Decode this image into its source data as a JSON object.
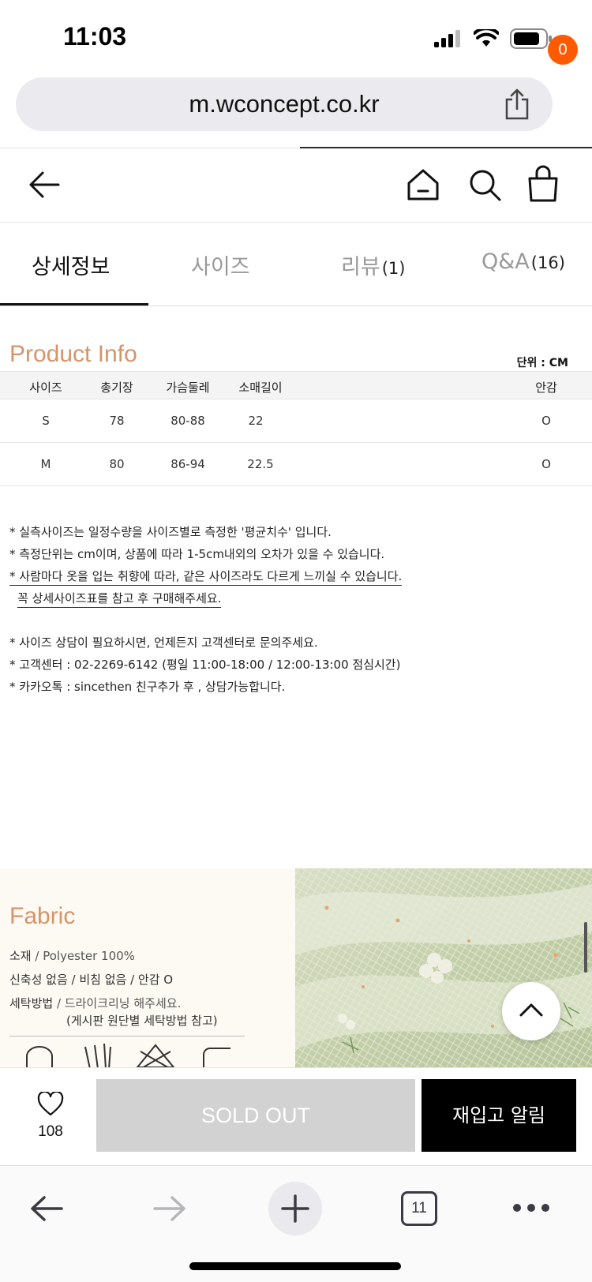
{
  "status_bar": {
    "time": "11:03"
  },
  "browser": {
    "url": "m.wconcept.co.kr",
    "tab_count": "11"
  },
  "header": {
    "cart_count": "0"
  },
  "tabs": [
    {
      "label": "상세정보",
      "count": ""
    },
    {
      "label": "사이즈",
      "count": ""
    },
    {
      "label": "리뷰",
      "count": "(1)"
    },
    {
      "label": "Q&A",
      "count": "(16)"
    }
  ],
  "product_info": {
    "title": "Product Info",
    "unit": "단위 : CM",
    "columns": [
      "사이즈",
      "총기장",
      "가슴둘레",
      "소매길이",
      "안감"
    ],
    "rows": [
      [
        "S",
        "78",
        "80-88",
        "22",
        "O"
      ],
      [
        "M",
        "80",
        "86-94",
        "22.5",
        "O"
      ]
    ]
  },
  "notes": {
    "n1": "* 실측사이즈는 일정수량을 사이즈별로 측정한 '평균치수' 입니다.",
    "n2": "* 측정단위는 cm이며, 상품에 따라 1-5cm내외의 오차가 있을 수 있습니다.",
    "n3": "* 사람마다 옷을 입는 취향에 따라, 같은 사이즈라도 다르게 느끼실 수 있습니다.",
    "n4": "꼭 상세사이즈표를 참고 후 구매해주세요.",
    "n5": "* 사이즈 상담이 필요하시면, 언제든지 고객센터로 문의주세요.",
    "n6": "* 고객센터 : 02-2269-6142 (평일 11:00-18:00 / 12:00-13:00 점심시간)",
    "n7": "* 카카오톡 : sincethen 친구추가 후 , 상담가능합니다."
  },
  "fabric": {
    "title": "Fabric",
    "material_label": "소재",
    "material_value": "/ Polyester 100%",
    "props": "신축성 없음 / 비침 없음 / 안감 O",
    "wash_label": "세탁방법",
    "wash_value": "/ 드라이크리닝 해주세요.",
    "wash_note": "(게시판 원단별 세탁방법 참고)"
  },
  "actions": {
    "like_count": "108",
    "soldout_label": "SOLD OUT",
    "restock_label": "재입고 알림"
  },
  "colors": {
    "accent": "#d5946a",
    "badge": "#ff5a00",
    "soldout": "#d2d2d2",
    "restock": "#000000"
  }
}
